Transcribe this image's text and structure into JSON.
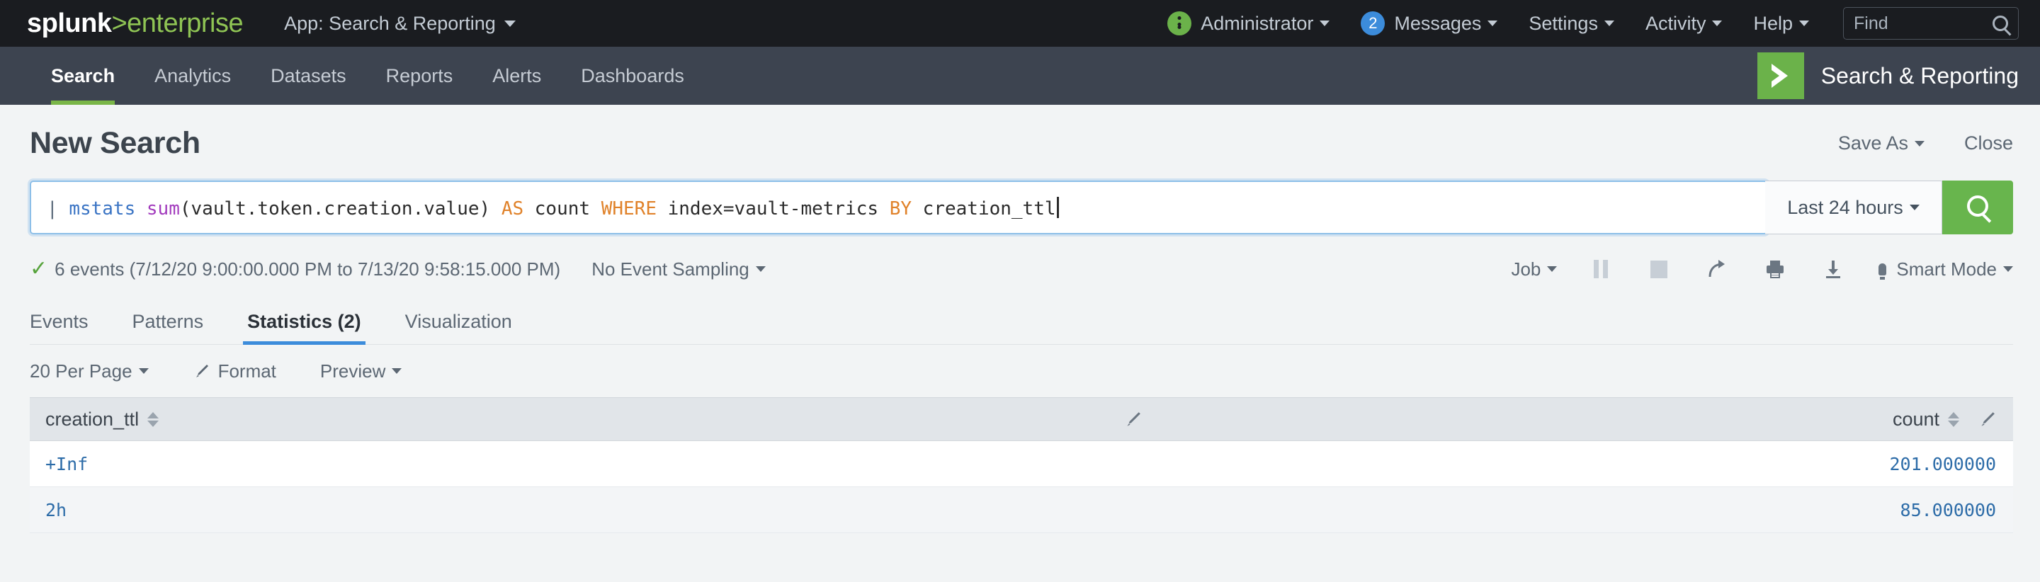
{
  "system_bar": {
    "logo_primary": "splunk",
    "logo_secondary": ">enterprise",
    "app_selector": "App: Search & Reporting",
    "user": "Administrator",
    "messages_label": "Messages",
    "messages_count": "2",
    "settings": "Settings",
    "activity": "Activity",
    "help": "Help",
    "find_placeholder": "Find",
    "accent_green": "#8fc454",
    "badge_blue": "#3c8cdb",
    "bar_bg": "#1a1c20"
  },
  "app_nav": {
    "items": [
      {
        "label": "Search",
        "active": true
      },
      {
        "label": "Analytics",
        "active": false
      },
      {
        "label": "Datasets",
        "active": false
      },
      {
        "label": "Reports",
        "active": false
      },
      {
        "label": "Alerts",
        "active": false
      },
      {
        "label": "Dashboards",
        "active": false
      }
    ],
    "brand_name": "Search & Reporting",
    "brand_icon": "chevron-right-icon",
    "brand_color": "#6bb24a",
    "bar_bg": "#3d4450",
    "active_underline": "#7ab648"
  },
  "page": {
    "title": "New Search",
    "save_as": "Save As",
    "close": "Close"
  },
  "search": {
    "query_parts": [
      {
        "text": "| ",
        "type": "pipe"
      },
      {
        "text": "mstats ",
        "type": "command"
      },
      {
        "text": "sum",
        "type": "function"
      },
      {
        "text": "(vault.token.creation.value) ",
        "type": "plain"
      },
      {
        "text": "AS ",
        "type": "keyword"
      },
      {
        "text": "count ",
        "type": "plain"
      },
      {
        "text": "WHERE ",
        "type": "keyword"
      },
      {
        "text": "index=vault-metrics ",
        "type": "plain"
      },
      {
        "text": "BY ",
        "type": "keyword"
      },
      {
        "text": "creation_ttl",
        "type": "plain"
      }
    ],
    "query_full": "| mstats sum(vault.token.creation.value) AS count WHERE index=vault-metrics BY creation_ttl",
    "time_range": "Last 24 hours",
    "search_button_icon": "magnifier-icon",
    "search_button_color": "#68b54d",
    "focus_border": "#8dbfe8"
  },
  "results_meta": {
    "status_icon": "check-icon",
    "summary": "6 events (7/12/20 9:00:00.000 PM to 7/13/20 9:58:15.000 PM)",
    "event_count": "6",
    "time_start": "7/12/20 9:00:00.000 PM",
    "time_end": "7/13/20 9:58:15.000 PM",
    "sampling": "No Event Sampling",
    "job": "Job",
    "mode": "Smart Mode",
    "icons": [
      "pause-icon",
      "stop-icon",
      "share-icon",
      "print-icon",
      "download-icon"
    ]
  },
  "tabs": [
    {
      "label": "Events",
      "active": false
    },
    {
      "label": "Patterns",
      "active": false
    },
    {
      "label": "Statistics (2)",
      "active": true
    },
    {
      "label": "Visualization",
      "active": false
    }
  ],
  "table_toolbar": {
    "per_page": "20 Per Page",
    "format": "Format",
    "preview": "Preview"
  },
  "results_table": {
    "columns": [
      {
        "name": "creation_ttl",
        "align": "left"
      },
      {
        "name": "count",
        "align": "right"
      }
    ],
    "rows": [
      {
        "creation_ttl": "+Inf",
        "count": "201.000000"
      },
      {
        "creation_ttl": "2h",
        "count": "85.000000"
      }
    ],
    "link_color": "#2d6ca8",
    "header_bg": "#e1e5e9"
  }
}
